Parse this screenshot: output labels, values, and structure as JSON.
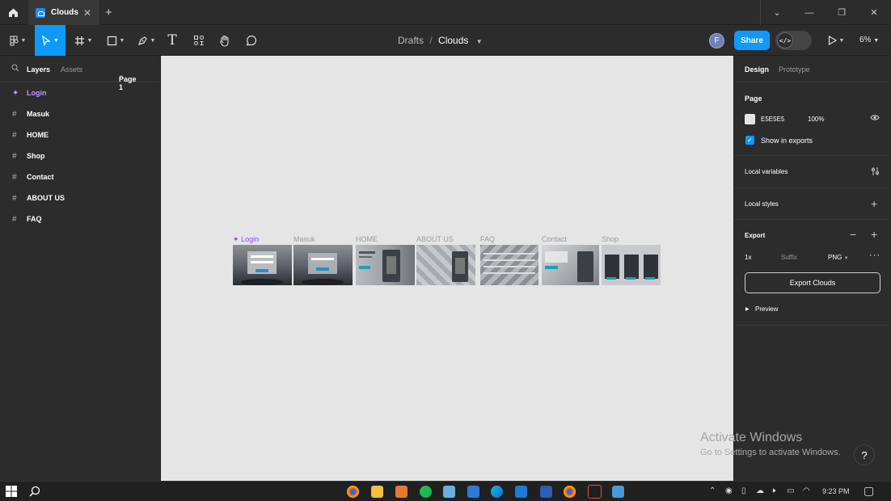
{
  "titlebar": {
    "tab_title": "Clouds",
    "new_tab": "+"
  },
  "window_controls": {
    "chevron": "⌄",
    "minimize": "—",
    "restore": "❐",
    "close": "✕"
  },
  "breadcrumb": {
    "parent": "Drafts",
    "separator": "/",
    "current": "Clouds"
  },
  "user": {
    "avatar_initial": "F"
  },
  "share": {
    "label": "Share"
  },
  "dev_mode": {
    "label": "</>"
  },
  "zoom": {
    "value": "6%"
  },
  "left_panel": {
    "tabs": {
      "layers": "Layers",
      "assets": "Assets",
      "page": "Page 1"
    },
    "layers": [
      {
        "name": "Login",
        "type": "component"
      },
      {
        "name": "Masuk",
        "type": "frame"
      },
      {
        "name": "HOME",
        "type": "frame"
      },
      {
        "name": "Shop",
        "type": "frame"
      },
      {
        "name": "Contact",
        "type": "frame"
      },
      {
        "name": "ABOUT US",
        "type": "frame"
      },
      {
        "name": "FAQ",
        "type": "frame"
      }
    ]
  },
  "canvas": {
    "background": "#E5E5E5",
    "frames": [
      {
        "label": "Login",
        "type": "component"
      },
      {
        "label": "Masuk"
      },
      {
        "label": "HOME"
      },
      {
        "label": "ABOUT US"
      },
      {
        "label": "FAQ"
      },
      {
        "label": "Contact"
      },
      {
        "label": "Shop"
      }
    ]
  },
  "right_panel": {
    "tabs": {
      "design": "Design",
      "prototype": "Prototype"
    },
    "page": {
      "title": "Page",
      "color": "E5E5E5",
      "opacity": "100%",
      "show_exports": "Show in exports"
    },
    "local_variables": "Local variables",
    "local_styles": "Local styles",
    "export": {
      "title": "Export",
      "scale": "1x",
      "suffix_placeholder": "Suffix",
      "format": "PNG",
      "button": "Export Clouds",
      "preview": "Preview"
    }
  },
  "watermark": {
    "line1": "Activate Windows",
    "line2": "Go to Settings to activate Windows."
  },
  "help": {
    "label": "?"
  },
  "taskbar": {
    "time": "9:23 PM"
  },
  "colors": {
    "accent": "#0D99FF",
    "component": "#9747FF",
    "panel": "#2C2C2C"
  }
}
